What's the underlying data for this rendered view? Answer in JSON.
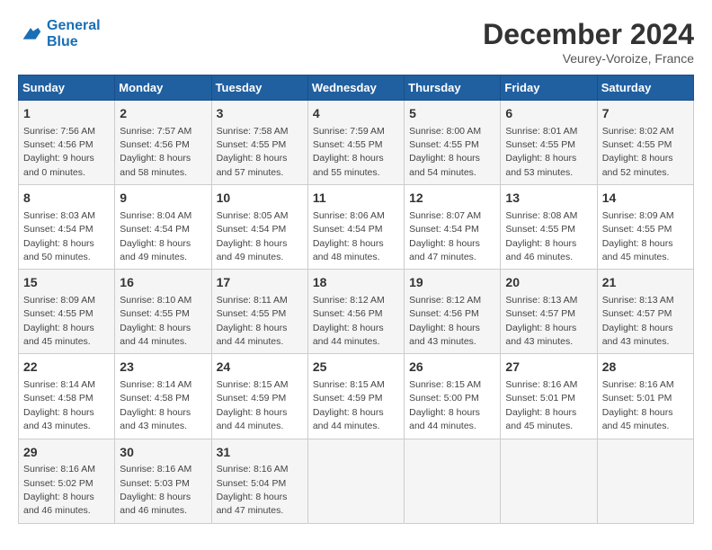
{
  "header": {
    "logo_line1": "General",
    "logo_line2": "Blue",
    "month_title": "December 2024",
    "location": "Veurey-Voroize, France"
  },
  "weekdays": [
    "Sunday",
    "Monday",
    "Tuesday",
    "Wednesday",
    "Thursday",
    "Friday",
    "Saturday"
  ],
  "weeks": [
    [
      {
        "day": "1",
        "sunrise": "7:56 AM",
        "sunset": "4:56 PM",
        "daylight": "9 hours and 0 minutes."
      },
      {
        "day": "2",
        "sunrise": "7:57 AM",
        "sunset": "4:56 PM",
        "daylight": "8 hours and 58 minutes."
      },
      {
        "day": "3",
        "sunrise": "7:58 AM",
        "sunset": "4:55 PM",
        "daylight": "8 hours and 57 minutes."
      },
      {
        "day": "4",
        "sunrise": "7:59 AM",
        "sunset": "4:55 PM",
        "daylight": "8 hours and 55 minutes."
      },
      {
        "day": "5",
        "sunrise": "8:00 AM",
        "sunset": "4:55 PM",
        "daylight": "8 hours and 54 minutes."
      },
      {
        "day": "6",
        "sunrise": "8:01 AM",
        "sunset": "4:55 PM",
        "daylight": "8 hours and 53 minutes."
      },
      {
        "day": "7",
        "sunrise": "8:02 AM",
        "sunset": "4:55 PM",
        "daylight": "8 hours and 52 minutes."
      }
    ],
    [
      {
        "day": "8",
        "sunrise": "8:03 AM",
        "sunset": "4:54 PM",
        "daylight": "8 hours and 50 minutes."
      },
      {
        "day": "9",
        "sunrise": "8:04 AM",
        "sunset": "4:54 PM",
        "daylight": "8 hours and 49 minutes."
      },
      {
        "day": "10",
        "sunrise": "8:05 AM",
        "sunset": "4:54 PM",
        "daylight": "8 hours and 49 minutes."
      },
      {
        "day": "11",
        "sunrise": "8:06 AM",
        "sunset": "4:54 PM",
        "daylight": "8 hours and 48 minutes."
      },
      {
        "day": "12",
        "sunrise": "8:07 AM",
        "sunset": "4:54 PM",
        "daylight": "8 hours and 47 minutes."
      },
      {
        "day": "13",
        "sunrise": "8:08 AM",
        "sunset": "4:55 PM",
        "daylight": "8 hours and 46 minutes."
      },
      {
        "day": "14",
        "sunrise": "8:09 AM",
        "sunset": "4:55 PM",
        "daylight": "8 hours and 45 minutes."
      }
    ],
    [
      {
        "day": "15",
        "sunrise": "8:09 AM",
        "sunset": "4:55 PM",
        "daylight": "8 hours and 45 minutes."
      },
      {
        "day": "16",
        "sunrise": "8:10 AM",
        "sunset": "4:55 PM",
        "daylight": "8 hours and 44 minutes."
      },
      {
        "day": "17",
        "sunrise": "8:11 AM",
        "sunset": "4:55 PM",
        "daylight": "8 hours and 44 minutes."
      },
      {
        "day": "18",
        "sunrise": "8:12 AM",
        "sunset": "4:56 PM",
        "daylight": "8 hours and 44 minutes."
      },
      {
        "day": "19",
        "sunrise": "8:12 AM",
        "sunset": "4:56 PM",
        "daylight": "8 hours and 43 minutes."
      },
      {
        "day": "20",
        "sunrise": "8:13 AM",
        "sunset": "4:57 PM",
        "daylight": "8 hours and 43 minutes."
      },
      {
        "day": "21",
        "sunrise": "8:13 AM",
        "sunset": "4:57 PM",
        "daylight": "8 hours and 43 minutes."
      }
    ],
    [
      {
        "day": "22",
        "sunrise": "8:14 AM",
        "sunset": "4:58 PM",
        "daylight": "8 hours and 43 minutes."
      },
      {
        "day": "23",
        "sunrise": "8:14 AM",
        "sunset": "4:58 PM",
        "daylight": "8 hours and 43 minutes."
      },
      {
        "day": "24",
        "sunrise": "8:15 AM",
        "sunset": "4:59 PM",
        "daylight": "8 hours and 44 minutes."
      },
      {
        "day": "25",
        "sunrise": "8:15 AM",
        "sunset": "4:59 PM",
        "daylight": "8 hours and 44 minutes."
      },
      {
        "day": "26",
        "sunrise": "8:15 AM",
        "sunset": "5:00 PM",
        "daylight": "8 hours and 44 minutes."
      },
      {
        "day": "27",
        "sunrise": "8:16 AM",
        "sunset": "5:01 PM",
        "daylight": "8 hours and 45 minutes."
      },
      {
        "day": "28",
        "sunrise": "8:16 AM",
        "sunset": "5:01 PM",
        "daylight": "8 hours and 45 minutes."
      }
    ],
    [
      {
        "day": "29",
        "sunrise": "8:16 AM",
        "sunset": "5:02 PM",
        "daylight": "8 hours and 46 minutes."
      },
      {
        "day": "30",
        "sunrise": "8:16 AM",
        "sunset": "5:03 PM",
        "daylight": "8 hours and 46 minutes."
      },
      {
        "day": "31",
        "sunrise": "8:16 AM",
        "sunset": "5:04 PM",
        "daylight": "8 hours and 47 minutes."
      },
      null,
      null,
      null,
      null
    ]
  ]
}
